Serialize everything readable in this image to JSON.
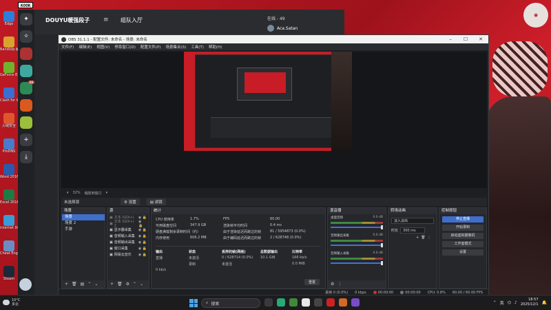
{
  "stamp": "KOOK",
  "desktop_icons": [
    {
      "label": "Edge",
      "color": "#2b7fd8"
    },
    {
      "label": "Bandizip\n解压缩",
      "color": "#d9a230"
    },
    {
      "label": "GeForce\nExperience",
      "color": "#6fb52c"
    },
    {
      "label": "Clash for\nWindows",
      "color": "#3a6fd0"
    },
    {
      "label": "火绒安全",
      "color": "#e0562c"
    },
    {
      "label": "ProDNS",
      "color": "#4a7ac9"
    },
    {
      "label": "Word 2016",
      "color": "#2b5aa8"
    },
    {
      "label": "Excel 2016",
      "color": "#1f7a45"
    },
    {
      "label": "Internet\nDownload",
      "color": "#3a9bd6"
    },
    {
      "label": "Cheat\nEngine",
      "color": "#6b8cc0"
    },
    {
      "label": "Steam",
      "color": "#1b2838"
    }
  ],
  "douyu": {
    "channel": "DOUYU暖强段子",
    "room": "组队入厅",
    "online": "在线 - 49",
    "user": "Aca.Satan",
    "rail_badges": [
      "",
      "",
      "",
      "",
      "88",
      ""
    ]
  },
  "obs": {
    "title": "OBS 31.1.1 - 配置文件: 未命名 - 场景: 未命名",
    "menu": [
      "文件(F)",
      "编辑(E)",
      "视图(V)",
      "停靠窗口(D)",
      "配置文件(P)",
      "场景集合(S)",
      "工具(T)",
      "帮助(H)"
    ],
    "zoom": "32%",
    "zoom_mode": "缩放到窗口",
    "toolbar": {
      "source_label": "未选择源",
      "settings_label": "设置",
      "filters_label": "滤镜"
    },
    "scenes": {
      "title": "场景",
      "items": [
        "场景",
        "场景 2",
        "手游"
      ],
      "active_index": 0
    },
    "sources": {
      "title": "源",
      "items": [
        {
          "label": "文本 (GDI+)",
          "dim": true
        },
        {
          "label": "文本 (GDI+) 2",
          "dim": true
        },
        {
          "label": "显示器采集",
          "dim": false
        },
        {
          "label": "音频输入采集",
          "dim": false
        },
        {
          "label": "音频输出采集",
          "dim": false
        },
        {
          "label": "窗口采集",
          "dim": false
        },
        {
          "label": "网易云音乐",
          "dim": false
        }
      ]
    },
    "stats": {
      "title": "统计",
      "rows": [
        [
          "CPU 使用率",
          "1.7%",
          "FPS",
          "60.00"
        ],
        [
          "可用磁盘空间",
          "347.9 GB",
          "渲染帧平均时间",
          "0.4 ms"
        ],
        [
          "硬盘满载剩余录制时间（约）",
          "",
          "由于渲染延迟而跳过的帧",
          "81 / 5954873 (0.0%)"
        ],
        [
          "内存使用",
          "606.2 MB",
          "由于编码延迟而跳过的帧",
          "2 / 628748 (0.0%)"
        ]
      ],
      "output_headers": [
        "输出",
        "状态",
        "丢弃的帧(网络)",
        "总数据输出",
        "比特率"
      ],
      "output_rows": [
        [
          "直播",
          "未激活",
          "0 / 628714 (0.0%)",
          "10.1 GiB",
          "166 kb/s"
        ],
        [
          "录制",
          "未激活",
          "",
          "0.0 MiB",
          "0 kb/s"
        ]
      ],
      "reset_label": "重置"
    },
    "mixer": {
      "title": "混音器",
      "channels": [
        {
          "name": "桌面音频",
          "db": "0.0 dB"
        },
        {
          "name": "音频输出采集",
          "db": "0.0 dB"
        },
        {
          "name": "音频输入采集",
          "db": "0.0 dB"
        }
      ]
    },
    "transitions": {
      "title": "转场动画",
      "selected": "淡入淡出",
      "duration_label": "时长",
      "duration": "300 ms"
    },
    "controls": {
      "title": "控制按钮",
      "buttons": [
        "停止直播",
        "开始录制",
        "启动虚拟摄像机",
        "工作室模式",
        "设置"
      ]
    },
    "status": {
      "frames": "丢帧 0 (0.0%)",
      "kbps": "0 kbps",
      "live_time": "00:00:00",
      "rec_time": "00:00:00",
      "cpu": "CPU: 0.8%",
      "fps": "60.00 / 60.00 FPS"
    }
  },
  "taskbar": {
    "weather_temp": "10°C",
    "weather_desc": "多云",
    "search_placeholder": "搜索",
    "lang": "英",
    "time": "18:57",
    "date": "2025/12/1"
  }
}
